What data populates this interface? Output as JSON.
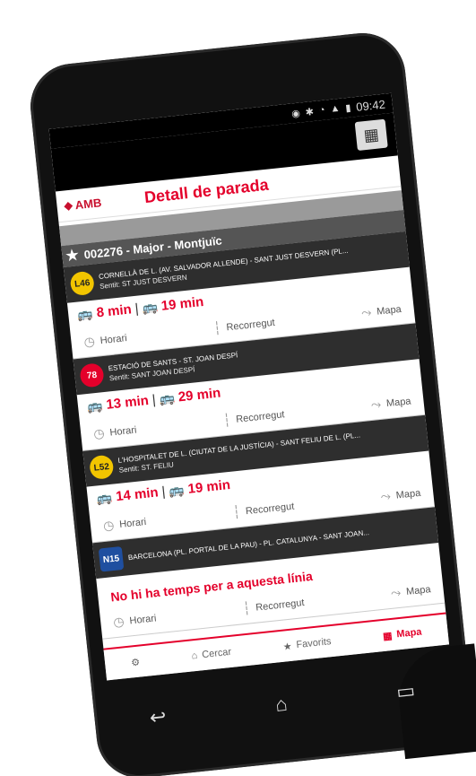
{
  "status_bar": {
    "time": "09:42"
  },
  "header": {
    "logo": "AMB",
    "title": "Detall de parada"
  },
  "stop": {
    "name": "002276 - Major - Montjuïc"
  },
  "lines": [
    {
      "code": "L46",
      "color": "#f2c500",
      "route": "CORNELLÀ DE L. (AV. SALVADOR ALLENDE) - SANT JUST DESVERN (PL...",
      "sub": "Sentit: ST JUST DESVERN",
      "time1": "8 min",
      "time2": "19 min"
    },
    {
      "code": "78",
      "color": "#e4002b",
      "route": "ESTACIÓ DE SANTS - ST. JOAN DESPÍ",
      "sub": "Sentit: SANT JOAN DESPÍ",
      "time1": "13 min",
      "time2": "29 min"
    },
    {
      "code": "L52",
      "color": "#f2c500",
      "route": "L'HOSPITALET DE L. (CIUTAT DE LA JUSTÍCIA) - SANT FELIU DE L. (PL...",
      "sub": "Sentit: ST. FELIU",
      "time1": "14 min",
      "time2": "19 min"
    },
    {
      "code": "N15",
      "color": "#1f4fa0",
      "route": "BARCELONA (PL. PORTAL DE LA PAU) - PL. CATALUNYA - SANT JOAN...",
      "sub": "",
      "notime": "No hi ha temps per a aquesta línia"
    }
  ],
  "actions": {
    "horari": "Horari",
    "recorregut": "Recorregut",
    "mapa": "Mapa"
  },
  "tabs": {
    "cercar": "Cercar",
    "favorits": "Favorits",
    "mapa": "Mapa"
  }
}
